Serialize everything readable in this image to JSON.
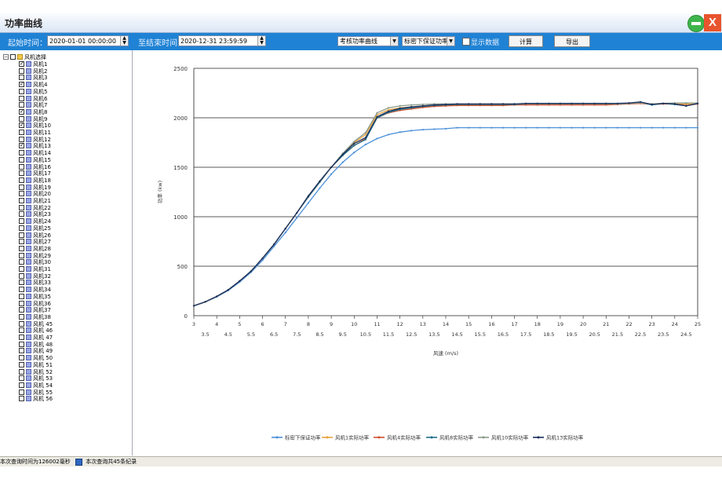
{
  "window": {
    "title": "功率曲线",
    "minimize_icon": "minimize-icon",
    "close_label": "X"
  },
  "toolbar": {
    "start_label": "起始时间：",
    "start_value": "2020-01-01 00:00:00",
    "end_label": "至结束时间",
    "end_value": "2020-12-31 23:59:59",
    "curve_select": "考核功率曲线",
    "density_select": "标密下保证功率",
    "show_data_label": "显示数据",
    "calc_label": "计算",
    "export_label": "导出"
  },
  "tree": {
    "root_label": "风机选择",
    "items": [
      {
        "label": "风机1",
        "checked": true
      },
      {
        "label": "风机2",
        "checked": false
      },
      {
        "label": "风机3",
        "checked": false
      },
      {
        "label": "风机4",
        "checked": true
      },
      {
        "label": "风机5",
        "checked": false
      },
      {
        "label": "风机6",
        "checked": false
      },
      {
        "label": "风机7",
        "checked": false
      },
      {
        "label": "风机8",
        "checked": true
      },
      {
        "label": "风机9",
        "checked": false
      },
      {
        "label": "风机10",
        "checked": true
      },
      {
        "label": "风机11",
        "checked": false
      },
      {
        "label": "风机12",
        "checked": false
      },
      {
        "label": "风机13",
        "checked": true
      },
      {
        "label": "风机14",
        "checked": false
      },
      {
        "label": "风机15",
        "checked": false
      },
      {
        "label": "风机16",
        "checked": false
      },
      {
        "label": "风机17",
        "checked": false
      },
      {
        "label": "风机18",
        "checked": false
      },
      {
        "label": "风机19",
        "checked": false
      },
      {
        "label": "风机20",
        "checked": false
      },
      {
        "label": "风机21",
        "checked": false
      },
      {
        "label": "风机22",
        "checked": false
      },
      {
        "label": "风机23",
        "checked": false
      },
      {
        "label": "风机24",
        "checked": false
      },
      {
        "label": "风机25",
        "checked": false
      },
      {
        "label": "风机26",
        "checked": false
      },
      {
        "label": "风机27",
        "checked": false
      },
      {
        "label": "风机28",
        "checked": false
      },
      {
        "label": "风机29",
        "checked": false
      },
      {
        "label": "风机30",
        "checked": false
      },
      {
        "label": "风机31",
        "checked": false
      },
      {
        "label": "风机32",
        "checked": false
      },
      {
        "label": "风机33",
        "checked": false
      },
      {
        "label": "风机34",
        "checked": false
      },
      {
        "label": "风机35",
        "checked": false
      },
      {
        "label": "风机36",
        "checked": false
      },
      {
        "label": "风机37",
        "checked": false
      },
      {
        "label": "风机38",
        "checked": false
      },
      {
        "label": "风机 45",
        "checked": false
      },
      {
        "label": "风机 46",
        "checked": false
      },
      {
        "label": "风机 47",
        "checked": false
      },
      {
        "label": "风机 48",
        "checked": false
      },
      {
        "label": "风机 49",
        "checked": false
      },
      {
        "label": "风机 50",
        "checked": false
      },
      {
        "label": "风机 51",
        "checked": false
      },
      {
        "label": "风机 52",
        "checked": false
      },
      {
        "label": "风机 53",
        "checked": false
      },
      {
        "label": "风机 54",
        "checked": false
      },
      {
        "label": "风机 55",
        "checked": false
      },
      {
        "label": "风机 56",
        "checked": false
      }
    ]
  },
  "status": {
    "left": "本次查询时间为126002毫秒",
    "right": "本次查询共45条纪录"
  },
  "chart_data": {
    "type": "line",
    "xlabel": "风速 (m/s)",
    "ylabel": "功率 (kw)",
    "xlim": [
      3,
      25
    ],
    "ylim": [
      0,
      2500
    ],
    "yticks": [
      0,
      500,
      1000,
      1500,
      2000,
      2500
    ],
    "xticks_major": [
      3,
      4,
      5,
      6,
      7,
      8,
      9,
      10,
      11,
      12,
      13,
      14,
      15,
      16,
      17,
      18,
      19,
      20,
      21,
      22,
      23,
      24,
      25
    ],
    "xticks_minor": [
      3.5,
      4.5,
      5.5,
      6.5,
      7.5,
      8.5,
      9.5,
      10.5,
      11.5,
      12.5,
      13.5,
      14.5,
      15.5,
      16.5,
      17.5,
      18.5,
      19.5,
      20.5,
      21.5,
      22.5,
      23.5,
      24.5
    ],
    "grid": "horizontal",
    "legend": "bottom",
    "x": [
      3,
      3.5,
      4,
      4.5,
      5,
      5.5,
      6,
      6.5,
      7,
      7.5,
      8,
      8.5,
      9,
      9.5,
      10,
      10.5,
      11,
      11.5,
      12,
      12.5,
      13,
      13.5,
      14,
      14.5,
      15,
      15.5,
      16,
      16.5,
      17,
      17.5,
      18,
      18.5,
      19,
      19.5,
      20,
      20.5,
      21,
      21.5,
      22,
      22.5,
      23,
      23.5,
      24,
      24.5,
      25
    ],
    "series": [
      {
        "name": "标密下保证功率",
        "color": "#4a90d9",
        "values": [
          100,
          140,
          190,
          255,
          340,
          440,
          560,
          700,
          840,
          990,
          1140,
          1290,
          1430,
          1550,
          1650,
          1730,
          1790,
          1830,
          1855,
          1870,
          1880,
          1885,
          1890,
          1900,
          1900,
          1900,
          1900,
          1900,
          1900,
          1900,
          1900,
          1900,
          1900,
          1900,
          1900,
          1900,
          1900,
          1900,
          1900,
          1900,
          1900,
          1900,
          1900,
          1900,
          1900
        ]
      },
      {
        "name": "风机1实际功率",
        "color": "#e8a33a",
        "values": [
          100,
          140,
          195,
          260,
          350,
          450,
          580,
          720,
          880,
          1040,
          1210,
          1360,
          1500,
          1630,
          1750,
          1830,
          2030,
          2080,
          2100,
          2110,
          2120,
          2125,
          2130,
          2130,
          2135,
          2135,
          2135,
          2135,
          2135,
          2140,
          2140,
          2140,
          2140,
          2140,
          2140,
          2140,
          2140,
          2140,
          2145,
          2150,
          2140,
          2145,
          2140,
          2140,
          2140
        ]
      },
      {
        "name": "风机4实际功率",
        "color": "#d0502c",
        "values": [
          100,
          140,
          195,
          260,
          350,
          450,
          580,
          720,
          880,
          1040,
          1200,
          1350,
          1500,
          1620,
          1720,
          1790,
          2000,
          2050,
          2075,
          2090,
          2105,
          2115,
          2120,
          2125,
          2125,
          2125,
          2125,
          2125,
          2130,
          2130,
          2130,
          2130,
          2130,
          2130,
          2130,
          2130,
          2130,
          2135,
          2140,
          2145,
          2135,
          2140,
          2140,
          2125,
          2140
        ]
      },
      {
        "name": "风机8实际功率",
        "color": "#1f6f8a",
        "values": [
          100,
          140,
          195,
          260,
          350,
          450,
          580,
          720,
          880,
          1040,
          1200,
          1350,
          1500,
          1620,
          1720,
          1780,
          2000,
          2055,
          2085,
          2100,
          2115,
          2125,
          2130,
          2135,
          2135,
          2135,
          2135,
          2135,
          2135,
          2140,
          2140,
          2140,
          2140,
          2140,
          2140,
          2140,
          2140,
          2140,
          2145,
          2155,
          2130,
          2145,
          2135,
          2120,
          2145
        ]
      },
      {
        "name": "风机10实际功率",
        "color": "#8a9a8a",
        "values": [
          100,
          140,
          195,
          260,
          350,
          450,
          580,
          720,
          880,
          1040,
          1210,
          1360,
          1500,
          1640,
          1760,
          1850,
          2050,
          2100,
          2120,
          2130,
          2135,
          2140,
          2140,
          2140,
          2140,
          2140,
          2140,
          2140,
          2140,
          2140,
          2140,
          2140,
          2140,
          2140,
          2140,
          2140,
          2140,
          2140,
          2145,
          2150,
          2140,
          2145,
          2150,
          2150,
          2150
        ]
      },
      {
        "name": "风机13实际功率",
        "color": "#1a2f5c",
        "values": [
          100,
          140,
          195,
          260,
          350,
          450,
          580,
          720,
          880,
          1040,
          1210,
          1360,
          1500,
          1630,
          1740,
          1800,
          2010,
          2065,
          2095,
          2110,
          2120,
          2130,
          2135,
          2140,
          2140,
          2140,
          2140,
          2140,
          2140,
          2145,
          2145,
          2145,
          2145,
          2145,
          2145,
          2145,
          2145,
          2145,
          2150,
          2160,
          2135,
          2145,
          2140,
          2120,
          2145
        ]
      }
    ]
  }
}
